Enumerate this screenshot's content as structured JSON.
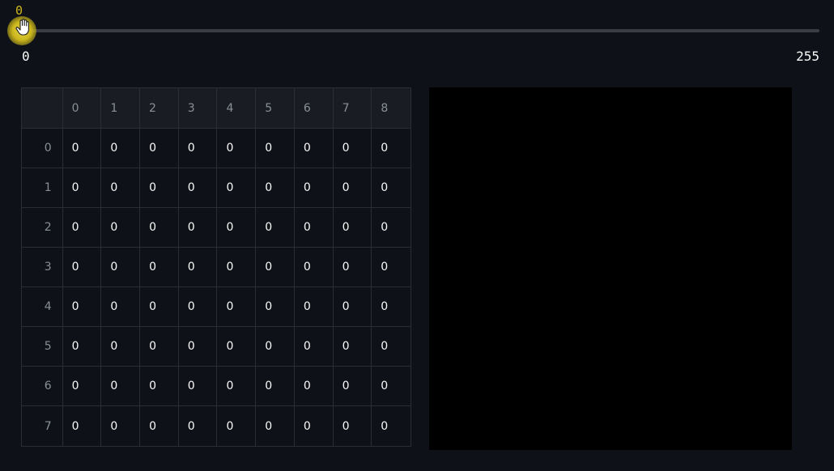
{
  "slider": {
    "current_value": "0",
    "min_label": "0",
    "max_label": "255",
    "fraction": 0,
    "accent_color": "#cdb81c"
  },
  "table": {
    "columns": [
      "0",
      "1",
      "2",
      "3",
      "4",
      "5",
      "6",
      "7",
      "8"
    ],
    "rows": [
      {
        "index": "0",
        "cells": [
          "0",
          "0",
          "0",
          "0",
          "0",
          "0",
          "0",
          "0",
          "0"
        ]
      },
      {
        "index": "1",
        "cells": [
          "0",
          "0",
          "0",
          "0",
          "0",
          "0",
          "0",
          "0",
          "0"
        ]
      },
      {
        "index": "2",
        "cells": [
          "0",
          "0",
          "0",
          "0",
          "0",
          "0",
          "0",
          "0",
          "0"
        ]
      },
      {
        "index": "3",
        "cells": [
          "0",
          "0",
          "0",
          "0",
          "0",
          "0",
          "0",
          "0",
          "0"
        ]
      },
      {
        "index": "4",
        "cells": [
          "0",
          "0",
          "0",
          "0",
          "0",
          "0",
          "0",
          "0",
          "0"
        ]
      },
      {
        "index": "5",
        "cells": [
          "0",
          "0",
          "0",
          "0",
          "0",
          "0",
          "0",
          "0",
          "0"
        ]
      },
      {
        "index": "6",
        "cells": [
          "0",
          "0",
          "0",
          "0",
          "0",
          "0",
          "0",
          "0",
          "0"
        ]
      },
      {
        "index": "7",
        "cells": [
          "0",
          "0",
          "0",
          "0",
          "0",
          "0",
          "0",
          "0",
          "0"
        ]
      }
    ]
  },
  "preview": {
    "fill_color": "#000000"
  }
}
